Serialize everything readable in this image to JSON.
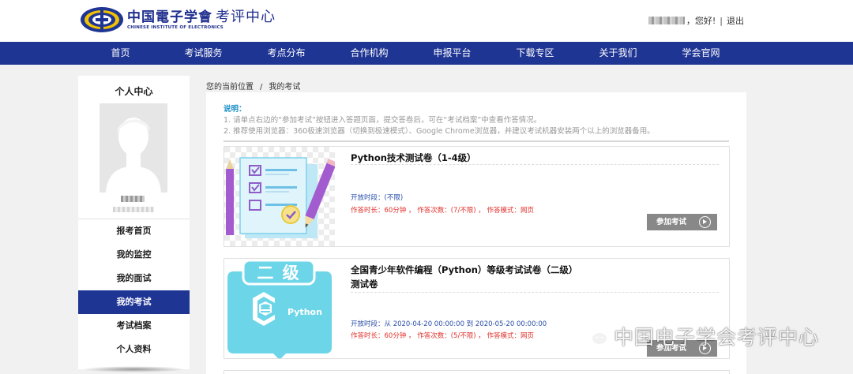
{
  "header": {
    "logo_cn": "中国電子学會",
    "logo_suffix": "考评中心",
    "logo_en": "CHINESE INSTITUTE OF ELECTRONICS",
    "greeting": "，您好!",
    "separator": "|",
    "logout": "退出"
  },
  "nav": {
    "items": [
      "首页",
      "考试服务",
      "考点分布",
      "合作机构",
      "申报平台",
      "下载专区",
      "关于我们",
      "学会官网"
    ]
  },
  "sidebar": {
    "title": "个人中心",
    "menu": [
      "报考首页",
      "我的监控",
      "我的面试",
      "我的考试",
      "考试档案",
      "个人资料"
    ],
    "active": "我的考试"
  },
  "breadcrumb": {
    "location": "您的当前位置",
    "separator": "/",
    "current": "我的考试"
  },
  "notice": {
    "title": "说明：",
    "line1": "1. 请单点右边的“参加考试”按钮进入答题页面，提交答卷后，可在“考试档案”中查看作答情况。",
    "line2": "2. 推荐使用浏览器：360极速浏览器（切换到极速模式）、Google Chrome浏览器，并建议考试机器安装两个以上的浏览器备用。"
  },
  "exams": [
    {
      "title": "Python技术测试卷（1-4级）",
      "title2": "",
      "open_time": "开放时段：(不限)",
      "details": "作答时长：60分钟 ， 作答次数：(7/不限) ， 作答模式：网页",
      "button": "参加考试"
    },
    {
      "title": "全国青少年软件编程（Python）等级考试试卷（二级）",
      "title2": "测试卷",
      "badge": "二 级",
      "logo_text": "Python",
      "open_time": "开放时段：从 2020-04-20 00:00:00 到 2020-05-20 00:00:00",
      "details": "作答时长：60分钟 ， 作答次数：(5/不限) ， 作答模式：网页",
      "button": "参加考试"
    }
  ],
  "watermark": "中国电子学会考评中心",
  "colors": {
    "nav_bg": "#1f3594",
    "accent_blue": "#1a8fc8",
    "alert_red": "#e0302a",
    "button_gray": "#888888"
  }
}
